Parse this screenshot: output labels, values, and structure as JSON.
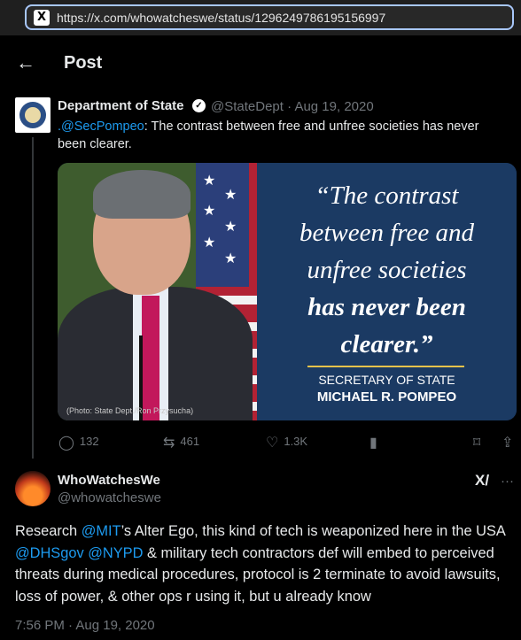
{
  "browser": {
    "favicon": "X",
    "url": "https://x.com/whowatcheswe/status/1296249786195156997"
  },
  "header": {
    "back_icon": "←",
    "title": "Post"
  },
  "quoted_post": {
    "author_name": "Department of State",
    "handle_date": "@StateDept · Aug 19, 2020",
    "mention": ".@SecPompeo",
    "text": ": The contrast between free and unfree societies has never been clearer.",
    "media": {
      "quote_line1": "“The contrast",
      "quote_line2": "between free and",
      "quote_line3": "unfree societies",
      "quote_line4": "has never been",
      "quote_line5": "clearer.”",
      "title": "SECRETARY OF STATE",
      "name": "MICHAEL R. POMPEO",
      "credit": "(Photo: State Dept./Ron Przysucha)"
    },
    "actions": {
      "replies": "132",
      "reposts": "461",
      "likes": "1.3K"
    }
  },
  "reply_post": {
    "author_name": "WhoWatchesWe",
    "handle": "@whowatcheswe",
    "grok_label": "X/",
    "more": "···",
    "text_parts": {
      "p1": "Research ",
      "m1": "@MIT",
      "p2": "’s Alter Ego, this kind of tech is weaponized here in the USA ",
      "m2": "@DHSgov",
      "p3": " ",
      "m3": "@NYPD",
      "p4": " & military tech contractors def will embed to perceived threats during medical procedures, protocol is 2 terminate to avoid lawsuits, loss of power, & other ops r using it, but u already know"
    },
    "timestamp": "7:56 PM · Aug 19, 2020"
  },
  "colors": {
    "background": "#000000",
    "link": "#1d9bf0",
    "muted": "#71767b",
    "text": "#e7e9ea"
  }
}
